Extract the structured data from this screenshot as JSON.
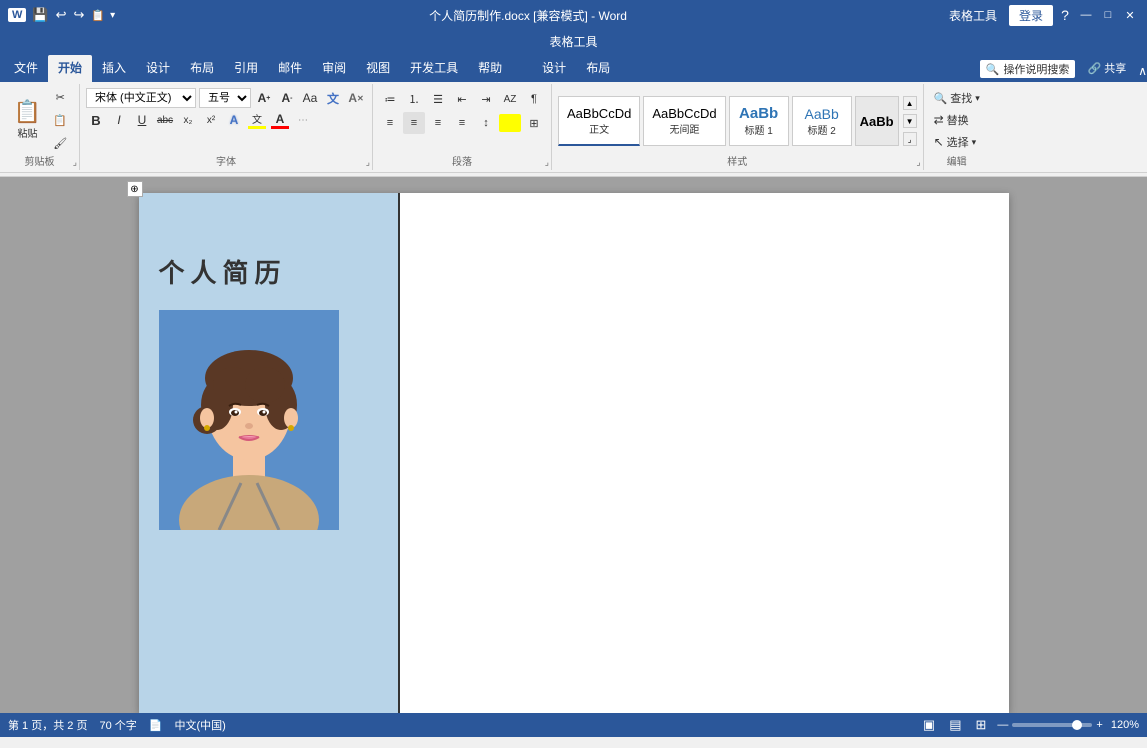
{
  "titleBar": {
    "title": "个人简历制作.docx [兼容模式] - Word",
    "tableTools": "表格工具",
    "loginBtn": "登录",
    "windowBtns": [
      "—",
      "□",
      "✕"
    ],
    "quickAccess": [
      "💾",
      "↩",
      "↪",
      "📋",
      "▾"
    ]
  },
  "ribbonTabs": {
    "tabs": [
      "文件",
      "开始",
      "插入",
      "设计",
      "布局",
      "引用",
      "邮件",
      "审阅",
      "视图",
      "开发工具",
      "帮助",
      "设计",
      "布局"
    ],
    "activeTab": "开始",
    "searchPlaceholder": "操作说明搜索",
    "shareBtn": "共享"
  },
  "clipboard": {
    "label": "剪贴板",
    "pasteBtn": "粘贴",
    "cutBtn": "✂",
    "copyBtn": "📋",
    "formatBtn": "刷"
  },
  "font": {
    "label": "字体",
    "name": "宋体 (中文正)",
    "size": "五号",
    "growBtn": "A↑",
    "shrinkBtn": "A↓",
    "caseBtn": "Aa",
    "clearBtn": "A清",
    "boldBtn": "B",
    "italicBtn": "I",
    "underlineBtn": "U",
    "strikeBtn": "abc",
    "subBtn": "x₂",
    "supBtn": "x²",
    "textHighlight": "文",
    "fontColorBtn": "A",
    "shadingBtn": "wen"
  },
  "paragraph": {
    "label": "段落",
    "bullets": "•≡",
    "numbering": "1≡",
    "multiLevel": "≡▾",
    "decreaseIndent": "◁≡",
    "increaseIndent": "▷≡",
    "sort": "AZ↓",
    "showMarks": "¶",
    "alignLeft": "≡L",
    "alignCenter": "≡C",
    "alignRight": "≡R",
    "justify": "≡J",
    "lineSpacing": "≡↕",
    "shading": "▭",
    "borders": "⊞"
  },
  "styles": {
    "label": "样式",
    "items": [
      {
        "name": "正文",
        "preview": "AaBbCcDd",
        "active": true
      },
      {
        "name": "无间距",
        "preview": "AaBbCcDd"
      },
      {
        "name": "标题 1",
        "preview": "AaBb"
      },
      {
        "name": "标题 2",
        "preview": "AaBb"
      }
    ]
  },
  "editing": {
    "label": "编辑",
    "findBtn": "查找",
    "replaceBtn": "替换",
    "selectBtn": "选择"
  },
  "document": {
    "table": {
      "leftCell": {
        "background": "#b8d4e8",
        "title": "个人简历",
        "photoAlt": "证件照"
      },
      "rightCell": {
        "content": ""
      }
    }
  },
  "statusBar": {
    "page": "第 1 页，共 2 页",
    "words": "70 个字",
    "lang": "中文(中国)",
    "docIcon": "📄",
    "zoom": "120%",
    "viewBtns": [
      "▣",
      "▤",
      "⊞"
    ]
  }
}
